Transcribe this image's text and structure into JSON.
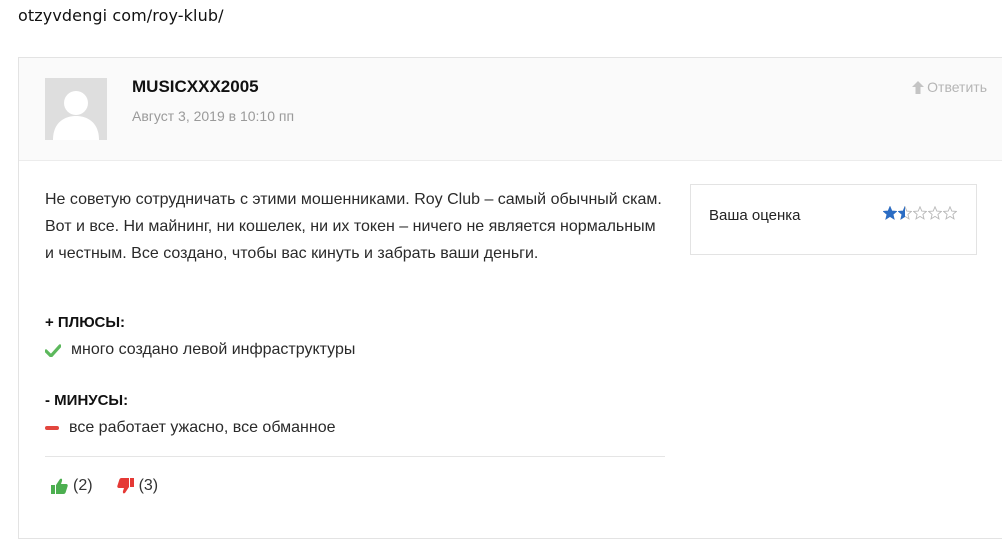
{
  "page": {
    "url_text": "otzyvdengi com/roy-klub/"
  },
  "comment": {
    "author": "MUSICXXX2005",
    "date": "Август 3, 2019 в 10:10 пп",
    "reply_label": "Ответить",
    "text": "Не советую сотрудничать с этими мошенниками. Roy Club – самый обычный скам. Вот и все. Ни майнинг, ни кошелек, ни их токен – ничего не является нормальным и честным. Все создано, чтобы вас кинуть и забрать ваши деньги.",
    "pros_title": "+ ПЛЮСЫ:",
    "pros": [
      "много создано левой инфраструктуры"
    ],
    "cons_title": "- МИНУСЫ:",
    "cons": [
      "все работает ужасно, все обманное"
    ],
    "likes": "(2)",
    "dislikes": "(3)"
  },
  "rating": {
    "label": "Ваша оценка",
    "value": 1.5,
    "max": 5,
    "color": "#2a6cc4"
  },
  "colors": {
    "pro_check": "#5cb85c",
    "con_minus": "#e2463e",
    "like": "#4caf50",
    "dislike": "#e53935"
  },
  "icons": {
    "reply": "arrow-up-icon",
    "pro": "check-icon",
    "con": "minus-icon",
    "like": "thumbs-up-icon",
    "dislike": "thumbs-down-icon",
    "avatar": "default-user-avatar"
  }
}
